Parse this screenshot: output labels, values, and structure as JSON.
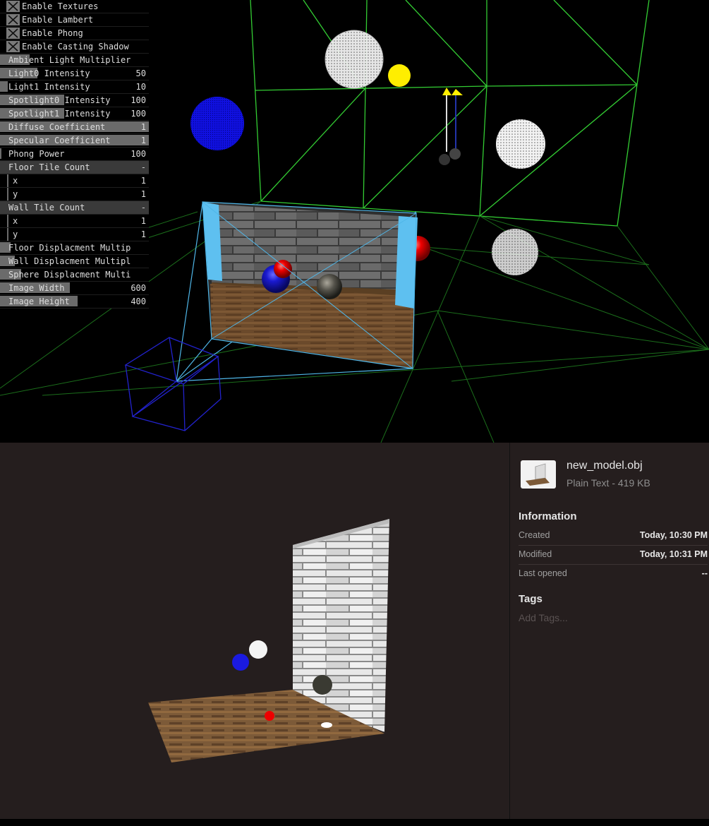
{
  "gui": {
    "checkboxes": [
      {
        "label": "Enable Textures",
        "checked": true
      },
      {
        "label": "Enable Lambert",
        "checked": true
      },
      {
        "label": "Enable Phong",
        "checked": true
      },
      {
        "label": "Enable Casting Shadow",
        "checked": true
      }
    ],
    "ambient": {
      "label": "Ambient Light Multiplier",
      "level": 0.2
    },
    "light0": {
      "label": "Light0 Intensity",
      "value": "50",
      "level": 0.25
    },
    "light1": {
      "label": "Light1 Intensity",
      "value": "10",
      "level": 0.05
    },
    "spot0": {
      "label": "Spotlight0 Intensity",
      "value": "100",
      "level": 0.43
    },
    "spot1": {
      "label": "Spotlight1 Intensity",
      "value": "100",
      "level": 0.43
    },
    "diffuse": {
      "label": "Diffuse Coefficient",
      "value": "1",
      "level": 1.0
    },
    "specular": {
      "label": "Specular Coefficient",
      "value": "1",
      "level": 1.0
    },
    "phong": {
      "label": "Phong Power",
      "value": "100",
      "level": 0.01
    },
    "floor_tiles": {
      "label": "Floor Tile Count",
      "toggle": "-",
      "x": {
        "label": "x",
        "value": "1"
      },
      "y": {
        "label": "y",
        "value": "1"
      }
    },
    "wall_tiles": {
      "label": "Wall Tile Count",
      "toggle": "-",
      "x": {
        "label": "x",
        "value": "1"
      },
      "y": {
        "label": "y",
        "value": "1"
      }
    },
    "floor_disp": {
      "label": "Floor Displacment Multip",
      "level": 0.07
    },
    "wall_disp": {
      "label": "Wall Displacment Multipl",
      "level": 0.1
    },
    "sphere_disp": {
      "label": "Sphere Displacment Multi",
      "level": 0.14
    },
    "img_width": {
      "label": "Image Width",
      "value": "600",
      "level": 0.47
    },
    "img_height": {
      "label": "Image Height",
      "value": "400",
      "level": 0.52
    }
  },
  "file": {
    "name": "new_model.obj",
    "kind": "Plain Text - 419 KB",
    "icon": "3d-model-file-icon"
  },
  "info": {
    "heading": "Information",
    "created": {
      "label": "Created",
      "value": "Today, 10:30 PM"
    },
    "modified": {
      "label": "Modified",
      "value": "Today, 10:31 PM"
    },
    "last_opened": {
      "label": "Last opened",
      "value": "--"
    }
  },
  "tags": {
    "heading": "Tags",
    "placeholder": "Add Tags..."
  },
  "colors": {
    "wireframe": "#33cc33",
    "camera_frustum": "#4fb6e8",
    "camera_box": "#2222cc",
    "light_marker": "#ffee00",
    "info_panel_bg": "#251e1e"
  }
}
